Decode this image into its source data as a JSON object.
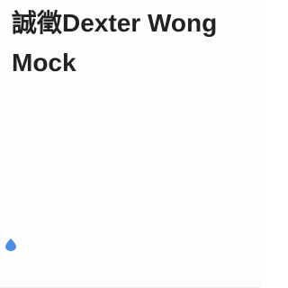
{
  "posting": {
    "title": "誠徵Dexter Wong Mock"
  },
  "colors": {
    "text": "#222222",
    "cursor_handle": "#4a8ee6",
    "background": "#fdfdfd"
  },
  "icons": {
    "cursor_handle": "text-cursor-handle-icon"
  }
}
